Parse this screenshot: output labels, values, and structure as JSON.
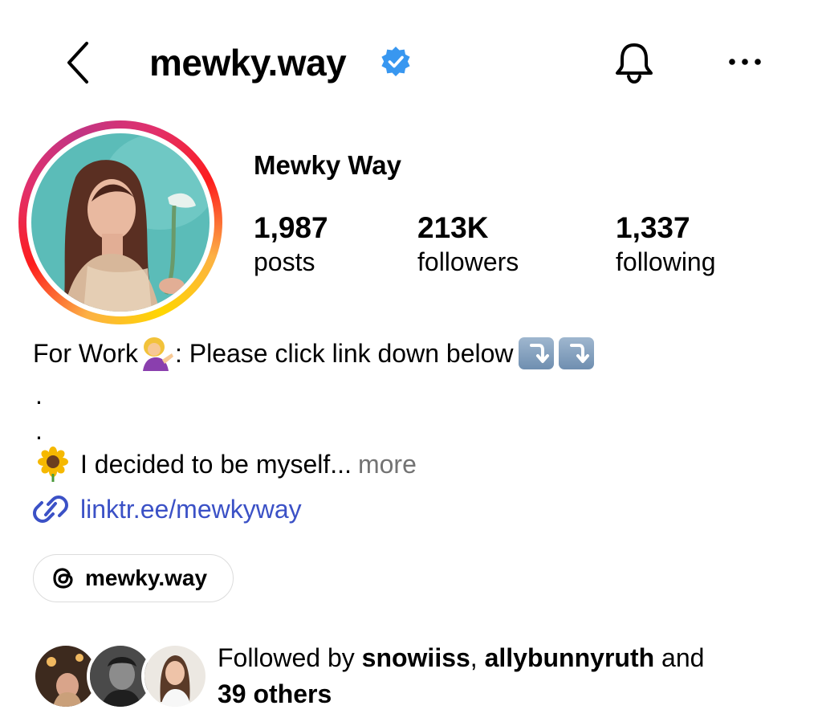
{
  "header": {
    "username": "mewky.way",
    "back_icon": "chevron-left-icon",
    "verified_icon": "verified-badge-icon",
    "notification_icon": "bell-icon",
    "more_icon": "more-horizontal-icon",
    "verified_color": "#3897f0"
  },
  "profile": {
    "display_name": "Mewky Way",
    "story_ring_colors": [
      "#fcb045",
      "#fd1d1d",
      "#c13584"
    ],
    "stats": {
      "posts": {
        "value": "1,987",
        "label": "posts"
      },
      "followers": {
        "value": "213K",
        "label": "followers"
      },
      "following": {
        "value": "1,337",
        "label": "following"
      }
    }
  },
  "bio": {
    "line1_prefix": "For Work",
    "line1_suffix": " : Please click link down below",
    "dot1": ".",
    "dot2": ".",
    "line2_text": "I decided to be myself...",
    "more": "more",
    "link": "linktr.ee/mewkyway",
    "link_color": "#3b51c6"
  },
  "threads": {
    "label": "mewky.way",
    "icon": "threads-icon"
  },
  "followed_by": {
    "prefix": "Followed by ",
    "user1": "snowiiss",
    "separator": ", ",
    "user2": "allybunnyruth",
    "conjunction": " and",
    "others": "39 others"
  }
}
